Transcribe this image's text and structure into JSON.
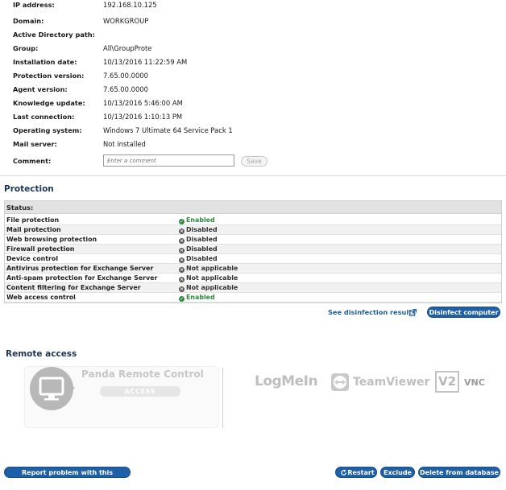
{
  "info": {
    "rows": [
      {
        "label": "IP address:",
        "value": "192.168.10.125"
      },
      {
        "label": "Domain:",
        "value": "WORKGROUP"
      },
      {
        "label": "Active Directory path:",
        "value": ""
      },
      {
        "label": "Group:",
        "value": "All\\GroupProte"
      },
      {
        "label": "Installation date:",
        "value": "10/13/2016 11:22:59 AM"
      },
      {
        "label": "Protection version:",
        "value": "7.65.00.0000"
      },
      {
        "label": "Agent version:",
        "value": "7.65.00.0000"
      },
      {
        "label": "Knowledge update:",
        "value": "10/13/2016 5:46:00 AM"
      },
      {
        "label": "Last connection:",
        "value": "10/13/2016 1:10:13 PM"
      },
      {
        "label": "Operating system:",
        "value": "Windows 7 Ultimate 64 Service Pack 1"
      },
      {
        "label": "Mail server:",
        "value": "Not installed"
      }
    ],
    "comment_label": "Comment:",
    "comment_placeholder": "Enter a comment",
    "save_label": "Save"
  },
  "protection": {
    "title": "Protection",
    "status_header": "Status:",
    "items": [
      {
        "name": "File protection",
        "status": "Enabled",
        "state": "enabled"
      },
      {
        "name": "Mail protection",
        "status": "Disabled",
        "state": "disabled"
      },
      {
        "name": "Web browsing protection",
        "status": "Disabled",
        "state": "disabled"
      },
      {
        "name": "Firewall protection",
        "status": "Disabled",
        "state": "disabled"
      },
      {
        "name": "Device control",
        "status": "Disabled",
        "state": "disabled"
      },
      {
        "name": "Antivirus protection for Exchange Server",
        "status": "Not applicable",
        "state": "disabled"
      },
      {
        "name": "Anti-spam protection for Exchange Server",
        "status": "Not applicable",
        "state": "disabled"
      },
      {
        "name": "Content filtering for Exchange Server",
        "status": "Not applicable",
        "state": "disabled"
      },
      {
        "name": "Web access control",
        "status": "Enabled",
        "state": "enabled"
      }
    ],
    "see_results_label": "See disinfection results",
    "disinfect_label": "Disinfect computer"
  },
  "remote": {
    "title": "Remote access",
    "panda_title": "Panda Remote Control",
    "access_label": "ACCESS",
    "logmein": "LogMeIn",
    "teamviewer": "TeamViewer",
    "vnc": "VNC",
    "vnc_mark": "V2"
  },
  "footer": {
    "report_label": "Report problem with this computer",
    "restart_label": "Restart",
    "exclude_label": "Exclude",
    "delete_label": "Delete from database"
  },
  "colors": {
    "accent": "#1f5fa6",
    "enabled": "#2e8b3e",
    "disabled": "#555555"
  }
}
